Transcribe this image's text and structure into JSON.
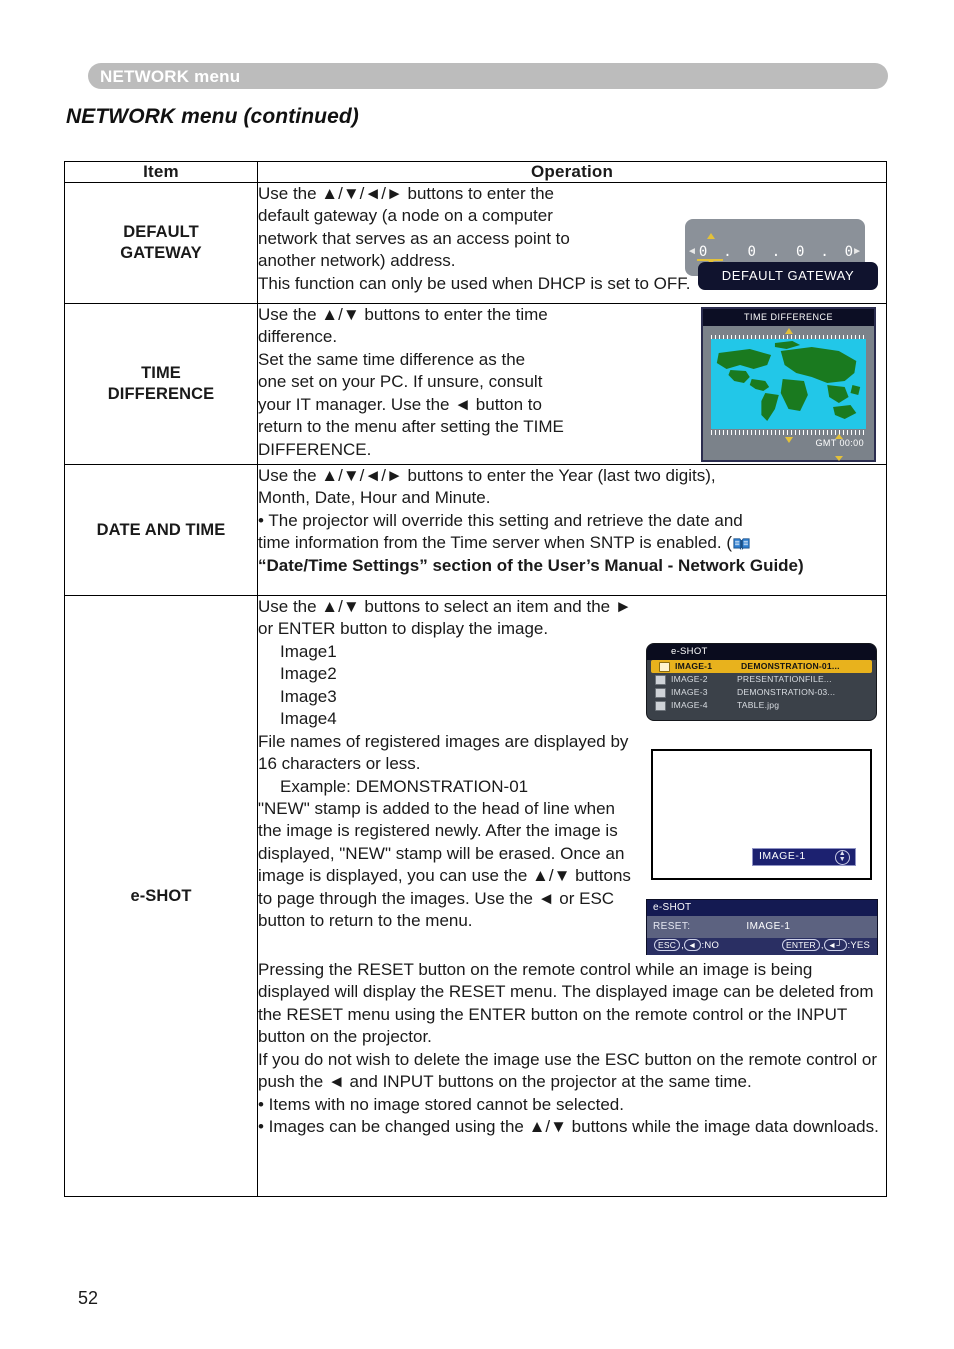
{
  "header": {
    "running_head": "NETWORK menu",
    "page_title": "NETWORK menu (continued)"
  },
  "table": {
    "columns": [
      "Item",
      "Operation"
    ],
    "rows": [
      {
        "item": "DEFAULT\nGATEWAY",
        "item_line1": "DEFAULT",
        "item_line2": "GATEWAY",
        "operation_lines": [
          "Use the ▲/▼/◄/► buttons to enter the",
          "default gateway (a node on a computer",
          "network that serves as an access point to",
          "another network) address.",
          "This function can only be used when DHCP is set to OFF."
        ],
        "osd": {
          "kind": "default-gateway",
          "digits": [
            "0",
            ".",
            "0",
            ".",
            "0",
            ".",
            "0"
          ],
          "label": "DEFAULT GATEWAY",
          "arrow_left": "◄",
          "arrow_right": "►"
        }
      },
      {
        "item_line1": "TIME",
        "item_line2": "DIFFERENCE",
        "operation_lines": [
          "Use the ▲/▼ buttons to enter the time",
          "difference.",
          "Set the same time difference as the",
          "one set on your PC. If unsure, consult",
          "your IT manager. Use the ◄ button to",
          "return to the menu after setting the TIME",
          "DIFFERENCE."
        ],
        "osd": {
          "kind": "time-difference",
          "title": "TIME DIFFERENCE",
          "gmt": "GMT 00:00"
        }
      },
      {
        "item_line1": "DATE AND TIME",
        "item_line2": "",
        "operation_lines": [
          "Use the ▲/▼/◄/► buttons to enter the Year (last two digits),",
          "Month, Date, Hour and Minute.",
          "• The projector will override this setting and retrieve the date and",
          "time information from the Time server when SNTP is enabled. ("
        ],
        "operation_bold": "“Date/Time Settings” section of the User’s Manual - Network Guide)"
      },
      {
        "item_line1": "e-SHOT",
        "item_line2": "",
        "paragraphs": [
          "Use the ▲/▼ buttons to select an item and the ► or ENTER button to display the image.",
          "File names of registered images are displayed by 16 characters or less.",
          "\"NEW\" stamp is added to the head of line when the image is registered newly. After the image is displayed, \"NEW\" stamp will be erased. Once an image is displayed, you can use the ▲/▼ buttons to page through the images. Use the ◄ or ESC button to return to the menu.",
          "Pressing the RESET button on the remote control while an image is being displayed will display the RESET menu. The displayed image can be deleted from the RESET menu using the ENTER button on the remote control or the INPUT button on the projector.",
          "If you do not wish to delete the image use the ESC button on the remote control or push the ◄ and INPUT buttons on the projector at the same time.",
          "• Items with no image stored cannot be selected.",
          "• Images can be changed using the ▲/▼ buttons while the image data downloads."
        ],
        "image_items": [
          "Image1",
          "Image2",
          "Image3",
          "Image4"
        ],
        "example_line": "Example: DEMONSTRATION-01",
        "osd_list": {
          "kind": "e-shot-list",
          "title": "e-SHOT",
          "rows": [
            {
              "name": "IMAGE-1",
              "file": "DEMONSTRATION-01...",
              "selected": true
            },
            {
              "name": "IMAGE-2",
              "file": "PRESENTATIONFILE...",
              "selected": false
            },
            {
              "name": "IMAGE-3",
              "file": "DEMONSTRATION-03...",
              "selected": false
            },
            {
              "name": "IMAGE-4",
              "file": "TABLE.jpg",
              "selected": false
            }
          ]
        },
        "osd_image": {
          "kind": "displayed-image",
          "badge": "IMAGE-1"
        },
        "osd_reset": {
          "kind": "e-shot-reset",
          "title": "e-SHOT",
          "label": "RESET:",
          "value": "IMAGE-1",
          "no_keys": "ESC",
          "no_arrow": "◄",
          "no_text": ":NO",
          "yes_keys": "ENTER",
          "yes_arrow": "◄┘",
          "yes_text": ":YES"
        }
      }
    ]
  },
  "footer": {
    "page_number": "52"
  }
}
